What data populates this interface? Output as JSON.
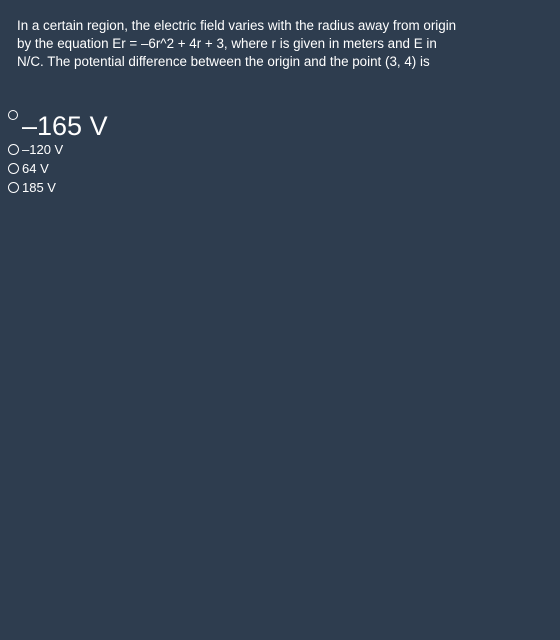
{
  "question": {
    "text": "In a certain region, the electric field varies with the radius away from origin by the equation Er = –6r^2 + 4r + 3, where r is given in meters and E in N/C. The potential difference between the origin and the point (3, 4) is"
  },
  "options": [
    {
      "label": "–165 V",
      "selected": false
    },
    {
      "label": "–120 V",
      "selected": false
    },
    {
      "label": "64 V",
      "selected": false
    },
    {
      "label": "185 V",
      "selected": false
    }
  ]
}
